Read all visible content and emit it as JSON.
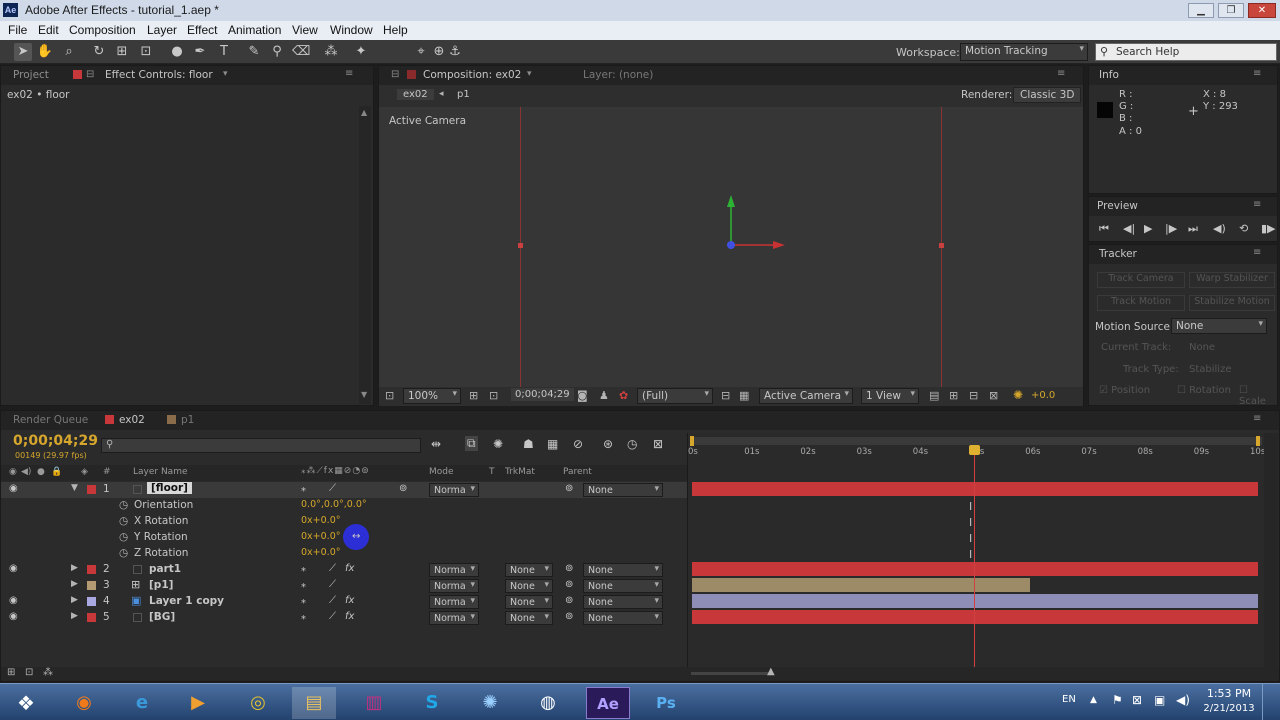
{
  "window": {
    "title": "Adobe After Effects - tutorial_1.aep *",
    "app_icon": "Ae",
    "controls": [
      "minimize",
      "maximize",
      "close"
    ]
  },
  "menu": [
    "File",
    "Edit",
    "Composition",
    "Layer",
    "Effect",
    "Animation",
    "View",
    "Window",
    "Help"
  ],
  "toolbar": {
    "workspace_label": "Workspace:",
    "workspace_value": "Motion Tracking",
    "search_placeholder": "Search Help"
  },
  "left_panel": {
    "tab_project": "Project",
    "tab_effect_controls": "Effect Controls: floor",
    "breadcrumb": "ex02 • floor"
  },
  "comp_panel": {
    "tab": "Composition: ex02",
    "tab_layer": "Layer: (none)",
    "crumb1": "ex02",
    "crumb2": "p1",
    "renderer_label": "Renderer:",
    "renderer_value": "Classic 3D",
    "view_label": "Active Camera",
    "zoom": "100%",
    "timecode": "0;00;04;29",
    "resolution": "(Full)",
    "camera": "Active Camera",
    "views": "1 View",
    "exposure": "+0.0"
  },
  "info_panel": {
    "title": "Info",
    "r": "R :",
    "g": "G :",
    "b": "B :",
    "a": "A : 0",
    "x": "X : 8",
    "y": "Y : 293"
  },
  "preview_panel": {
    "title": "Preview"
  },
  "tracker_panel": {
    "title": "Tracker",
    "track_camera": "Track Camera",
    "warp_stabilizer": "Warp Stabilizer",
    "track_motion": "Track Motion",
    "stabilize_motion": "Stabilize Motion",
    "motion_source_label": "Motion Source:",
    "motion_source_value": "None",
    "current_track_label": "Current Track:",
    "current_track_value": "None",
    "track_type_label": "Track Type:",
    "track_type_value": "Stabilize",
    "position": "Position",
    "rotation": "Rotation",
    "scale": "Scale"
  },
  "timeline": {
    "tab_render": "Render Queue",
    "tab_ex02": "ex02",
    "tab_p1": "p1",
    "timecode": "0;00;04;29",
    "frame_info": "00149 (29.97 fps)",
    "col_layer_name": "Layer Name",
    "col_mode": "Mode",
    "col_t": "T",
    "col_trkmat": "TrkMat",
    "col_parent": "Parent",
    "col_num": "#",
    "ruler": [
      "0s",
      "01s",
      "02s",
      "03s",
      "04s",
      "05s",
      "06s",
      "07s",
      "08s",
      "09s",
      "10s"
    ],
    "layers": [
      {
        "num": "1",
        "name": "[floor]",
        "mode": "Norma",
        "trkmat": "",
        "parent": "None",
        "color": "#c8373a"
      },
      {
        "num": "2",
        "name": "part1",
        "mode": "Norma",
        "trkmat": "None",
        "parent": "None",
        "color": "#c8373a"
      },
      {
        "num": "3",
        "name": "[p1]",
        "mode": "Norma",
        "trkmat": "None",
        "parent": "None",
        "color": "#b39a72"
      },
      {
        "num": "4",
        "name": "Layer 1 copy",
        "mode": "Norma",
        "trkmat": "None",
        "parent": "None",
        "color": "#a9a8e0"
      },
      {
        "num": "5",
        "name": "[BG]",
        "mode": "Norma",
        "trkmat": "None",
        "parent": "None",
        "color": "#c8373a"
      }
    ],
    "props": [
      {
        "name": "Orientation",
        "value": "0.0°,0.0°,0.0°"
      },
      {
        "name": "X Rotation",
        "value": "0x+0.0°"
      },
      {
        "name": "Y Rotation",
        "value": "0x+0.0°"
      },
      {
        "name": "Z Rotation",
        "value": "0x+0.0°"
      }
    ],
    "playhead_fraction": 0.498
  },
  "taskbar": {
    "lang": "EN",
    "time": "1:53 PM",
    "date": "2/21/2013",
    "apps": [
      "start",
      "firefox",
      "ie",
      "media",
      "chrome",
      "explorer",
      "winrar",
      "skype",
      "network",
      "cinema4d",
      "after-effects",
      "photoshop"
    ]
  }
}
